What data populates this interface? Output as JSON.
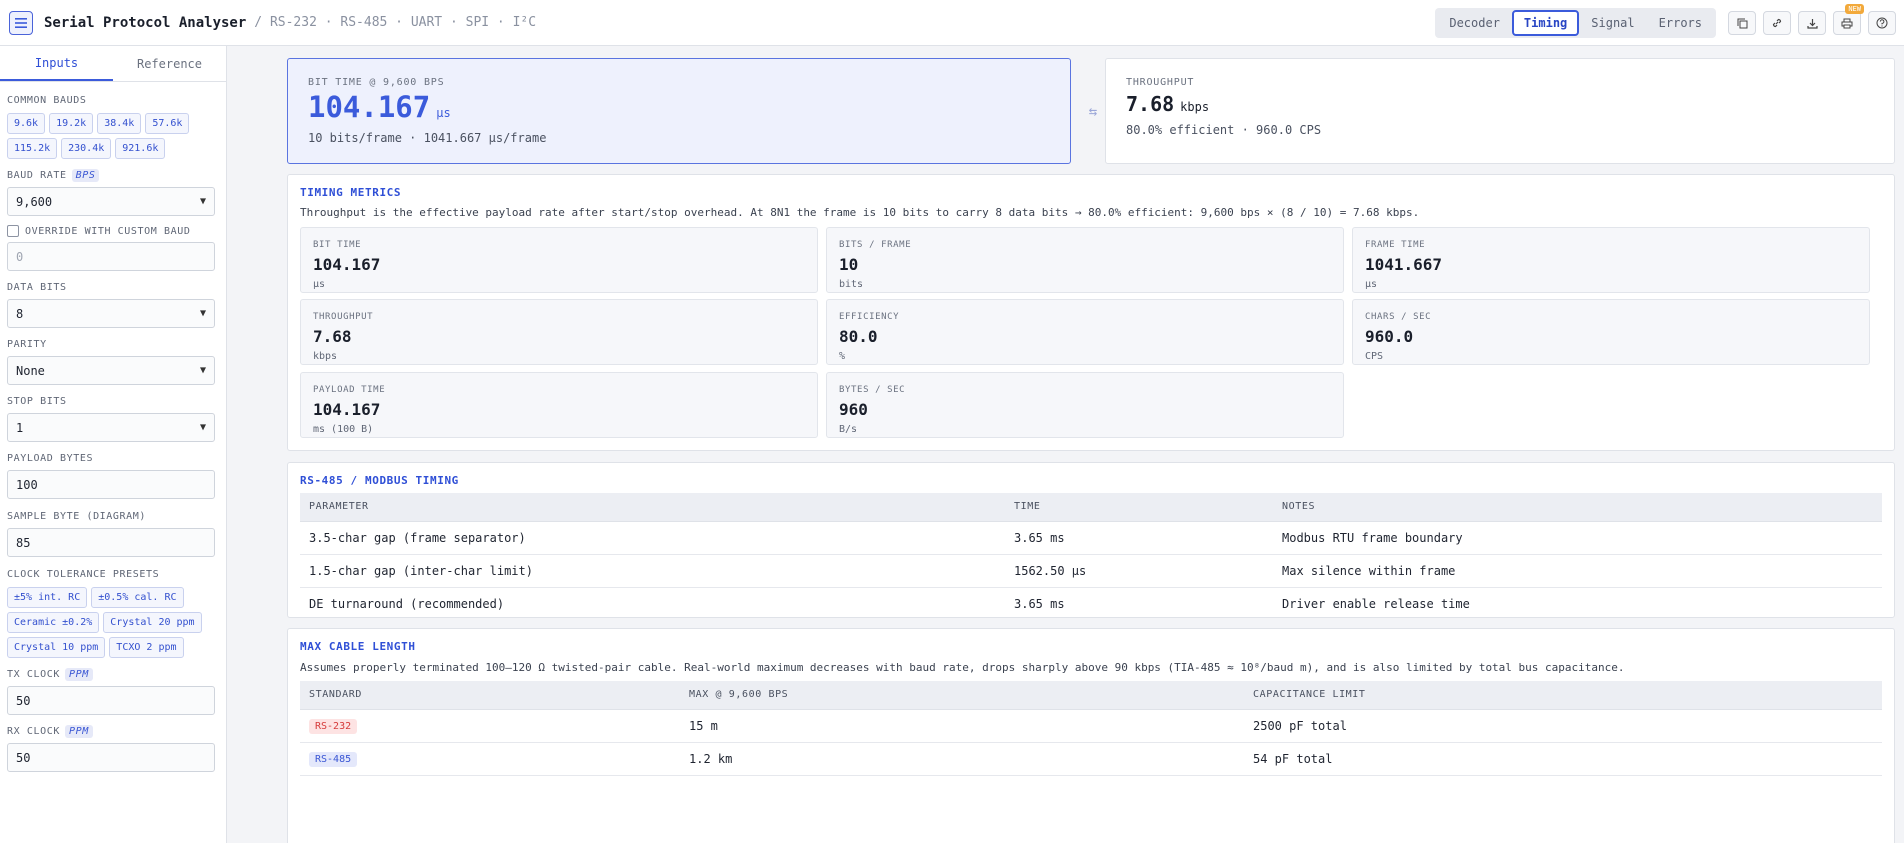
{
  "header": {
    "title": "Serial Protocol Analyser",
    "subtitle": "/ RS-232 · RS-485 · UART · SPI · I²C",
    "tabs": [
      {
        "label": "Decoder",
        "active": false
      },
      {
        "label": "Timing",
        "active": true
      },
      {
        "label": "Signal",
        "active": false
      },
      {
        "label": "Errors",
        "active": false
      }
    ],
    "badge": "NEW",
    "icons": [
      "copy-icon",
      "link-icon",
      "download-icon",
      "print-icon",
      "help-icon"
    ]
  },
  "sidebar": {
    "tabs": [
      {
        "label": "Inputs",
        "active": true
      },
      {
        "label": "Reference",
        "active": false
      }
    ],
    "common_bauds_label": "COMMON BAUDS",
    "common_bauds": [
      "9.6k",
      "19.2k",
      "38.4k",
      "57.6k",
      "115.2k",
      "230.4k",
      "921.6k"
    ],
    "baud_rate_label": "BAUD RATE",
    "baud_rate_unit": "BPS",
    "baud_rate_value": "9,600",
    "override_label": "OVERRIDE WITH CUSTOM BAUD",
    "custom_baud_placeholder": "0",
    "data_bits_label": "DATA BITS",
    "data_bits_value": "8",
    "parity_label": "PARITY",
    "parity_value": "None",
    "stop_bits_label": "STOP BITS",
    "stop_bits_value": "1",
    "payload_label": "PAYLOAD BYTES",
    "payload_value": "100",
    "sample_label": "SAMPLE BYTE (DIAGRAM)",
    "sample_value": "85",
    "tolerance_label": "CLOCK TOLERANCE PRESETS",
    "tolerance_presets": [
      "±5% int. RC",
      "±0.5% cal. RC",
      "Ceramic ±0.2%",
      "Crystal 20 ppm",
      "Crystal 10 ppm",
      "TCXO 2 ppm"
    ],
    "tx_label": "TX CLOCK",
    "tx_unit": "PPM",
    "tx_value": "50",
    "rx_label": "RX CLOCK",
    "rx_unit": "PPM",
    "rx_value": "50"
  },
  "hero": {
    "bit_time_label": "BIT TIME @ 9,600 BPS",
    "bit_time_value": "104.167",
    "bit_time_unit": "µs",
    "bit_time_sub": "10 bits/frame · 1041.667 µs/frame",
    "throughput_label": "THROUGHPUT",
    "throughput_value": "7.68",
    "throughput_unit": "kbps",
    "throughput_sub": "80.0% efficient · 960.0 CPS"
  },
  "timing": {
    "title": "TIMING METRICS",
    "note": "Throughput is the effective payload rate after start/stop overhead. At 8N1 the frame is 10 bits to carry 8 data bits → 80.0% efficient: 9,600 bps × (8 / 10) = 7.68 kbps.",
    "metrics": [
      {
        "label": "BIT TIME",
        "value": "104.167",
        "unit": "µs"
      },
      {
        "label": "BITS / FRAME",
        "value": "10",
        "unit": "bits"
      },
      {
        "label": "FRAME TIME",
        "value": "1041.667",
        "unit": "µs"
      },
      {
        "label": "THROUGHPUT",
        "value": "7.68",
        "unit": "kbps"
      },
      {
        "label": "EFFICIENCY",
        "value": "80.0",
        "unit": "%"
      },
      {
        "label": "CHARS / SEC",
        "value": "960.0",
        "unit": "CPS"
      },
      {
        "label": "PAYLOAD TIME",
        "value": "104.167",
        "unit": "ms (100 B)"
      },
      {
        "label": "BYTES / SEC",
        "value": "960",
        "unit": "B/s"
      }
    ]
  },
  "modbus": {
    "title": "RS-485 / MODBUS TIMING",
    "columns": [
      "PARAMETER",
      "TIME",
      "NOTES"
    ],
    "rows": [
      [
        "3.5-char gap (frame separator)",
        "3.65 ms",
        "Modbus RTU frame boundary"
      ],
      [
        "1.5-char gap (inter-char limit)",
        "1562.50 µs",
        "Max silence within frame"
      ],
      [
        "DE turnaround (recommended)",
        "3.65 ms",
        "Driver enable release time"
      ]
    ]
  },
  "cable": {
    "title": "MAX CABLE LENGTH",
    "note": "Assumes properly terminated 100–120 Ω twisted-pair cable. Real-world maximum decreases with baud rate, drops sharply above 90 kbps (TIA-485 ≈ 10⁸/baud m), and is also limited by total bus capacitance.",
    "columns": [
      "STANDARD",
      "MAX @ 9,600 BPS",
      "CAPACITANCE LIMIT"
    ],
    "rows": [
      {
        "standard": "RS-232",
        "color": "red",
        "max": "15 m",
        "cap": "2500 pF total"
      },
      {
        "standard": "RS-485",
        "color": "blue",
        "max": "1.2 km",
        "cap": "54 pF total"
      }
    ]
  }
}
